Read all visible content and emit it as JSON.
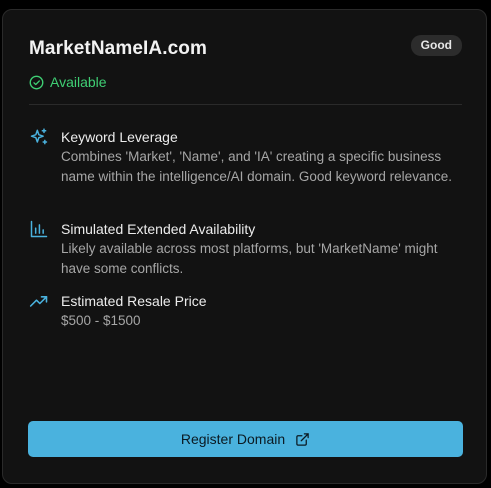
{
  "domain_card": {
    "domain_name": "MarketNameIA.com",
    "rating_badge": "Good",
    "status": "Available",
    "colors": {
      "accent": "#4ab2de",
      "status_green": "#3fcf74",
      "background": "#121212"
    },
    "features": [
      {
        "icon": "sparkles-icon",
        "title": "Keyword Leverage",
        "description": "Combines 'Market', 'Name', and 'IA' creating a specific business name within the intelligence/AI domain. Good keyword relevance."
      },
      {
        "icon": "bar-chart-icon",
        "title": "Simulated Extended Availability",
        "description": "Likely available across most platforms, but 'MarketName' might have some conflicts."
      },
      {
        "icon": "trending-up-icon",
        "title": "Estimated Resale Price",
        "description": "$500 - $1500"
      }
    ],
    "register_button": {
      "label": "Register Domain",
      "icon": "external-link-icon"
    }
  }
}
